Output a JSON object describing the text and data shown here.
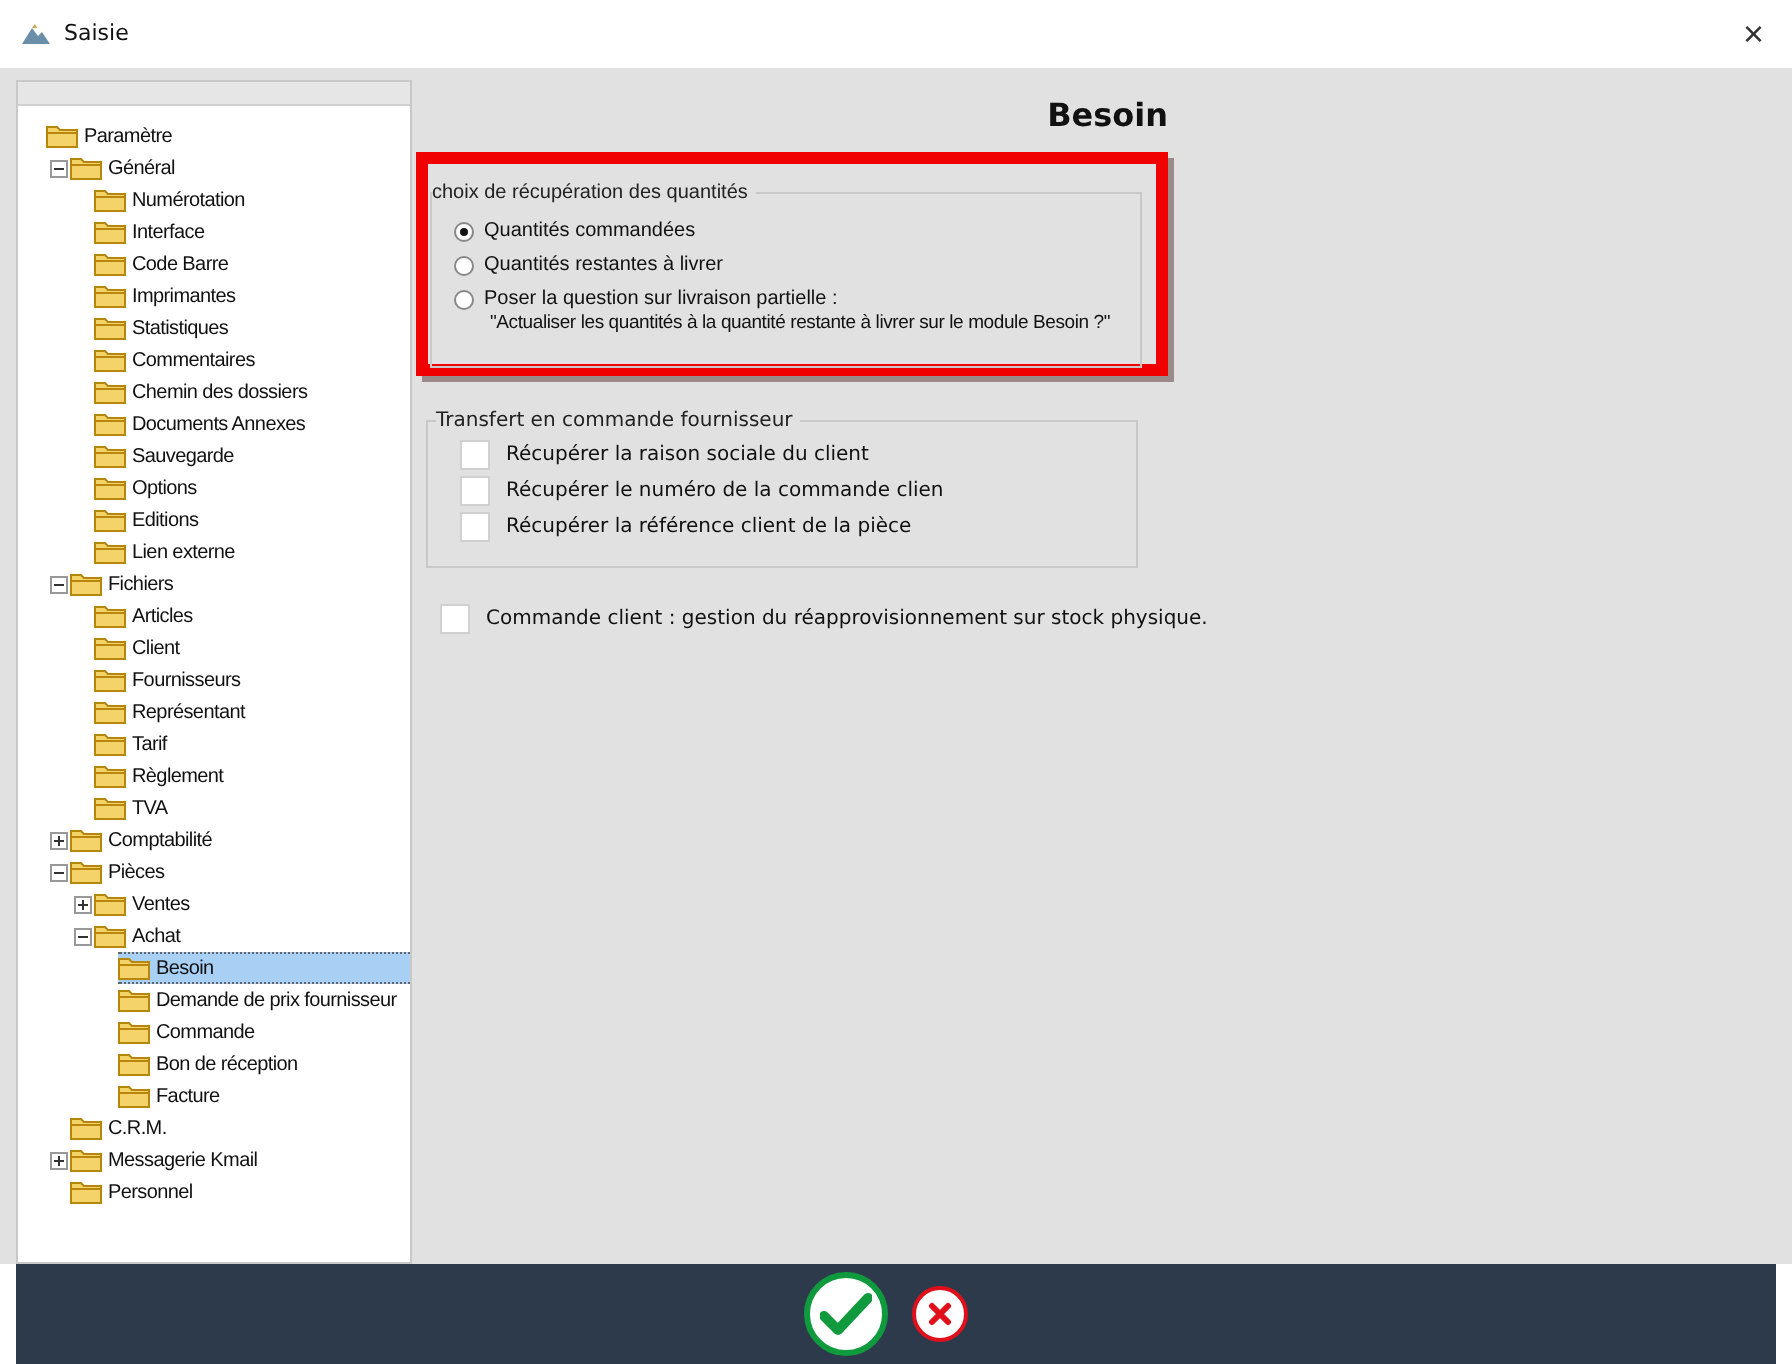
{
  "window": {
    "title": "Saisie",
    "close": "×"
  },
  "tree": [
    {
      "label": "Paramètre",
      "selected": false,
      "children": [
        {
          "label": "Général",
          "expanded": true,
          "selected": false,
          "children": [
            {
              "label": "Numérotation",
              "selected": false
            },
            {
              "label": "Interface",
              "selected": false
            },
            {
              "label": "Code Barre",
              "selected": false
            },
            {
              "label": "Imprimantes",
              "selected": false
            },
            {
              "label": "Statistiques",
              "selected": false
            },
            {
              "label": "Commentaires",
              "selected": false
            },
            {
              "label": "Chemin des dossiers",
              "selected": false
            },
            {
              "label": "Documents Annexes",
              "selected": false
            },
            {
              "label": "Sauvegarde",
              "selected": false
            },
            {
              "label": "Options",
              "selected": false
            },
            {
              "label": "Editions",
              "selected": false
            },
            {
              "label": "Lien externe",
              "selected": false
            }
          ]
        },
        {
          "label": "Fichiers",
          "expanded": true,
          "selected": false,
          "children": [
            {
              "label": "Articles",
              "selected": false
            },
            {
              "label": "Client",
              "selected": false
            },
            {
              "label": "Fournisseurs",
              "selected": false
            },
            {
              "label": "Représentant",
              "selected": false
            },
            {
              "label": "Tarif",
              "selected": false
            },
            {
              "label": "Règlement",
              "selected": false
            },
            {
              "label": "TVA",
              "selected": false
            }
          ]
        },
        {
          "label": "Comptabilité",
          "expanded": false,
          "selected": false
        },
        {
          "label": "Pièces",
          "expanded": true,
          "selected": false,
          "children": [
            {
              "label": "Ventes",
              "expanded": false,
              "selected": false
            },
            {
              "label": "Achat",
              "expanded": true,
              "selected": false,
              "children": [
                {
                  "label": "Besoin",
                  "selected": true
                },
                {
                  "label": "Demande de prix fournisseur",
                  "selected": false
                },
                {
                  "label": "Commande",
                  "selected": false
                },
                {
                  "label": "Bon de réception",
                  "selected": false
                },
                {
                  "label": "Facture",
                  "selected": false
                }
              ]
            }
          ]
        },
        {
          "label": "C.R.M.",
          "selected": false
        },
        {
          "label": "Messagerie Kmail",
          "expanded": false,
          "selected": false
        },
        {
          "label": "Personnel",
          "selected": false
        }
      ]
    }
  ],
  "panel": {
    "title": "Besoin",
    "quantity_group": {
      "legend": "choix de récupération des quantités",
      "highlighted": true,
      "options": [
        {
          "label": "Quantités commandées",
          "selected": true
        },
        {
          "label": "Quantités restantes à livrer",
          "selected": false
        },
        {
          "label": "Poser la question sur livraison partielle :",
          "note": "\"Actualiser les quantités à la quantité restante à livrer sur le module Besoin ?\"",
          "selected": false
        }
      ]
    },
    "transfer_group": {
      "legend": "Transfert en commande fournisseur",
      "options": [
        {
          "label": "Récupérer la raison sociale du client",
          "checked": false
        },
        {
          "label": "Récupérer le numéro de la commande clien",
          "checked": false
        },
        {
          "label": "Récupérer la référence client de la pièce",
          "checked": false
        }
      ]
    },
    "stock_option": {
      "label": "Commande client : gestion du réapprovisionnement sur stock physique.",
      "checked": false
    }
  },
  "footer": {
    "buttons": [
      {
        "kind": "confirm"
      },
      {
        "kind": "cancel"
      }
    ]
  }
}
